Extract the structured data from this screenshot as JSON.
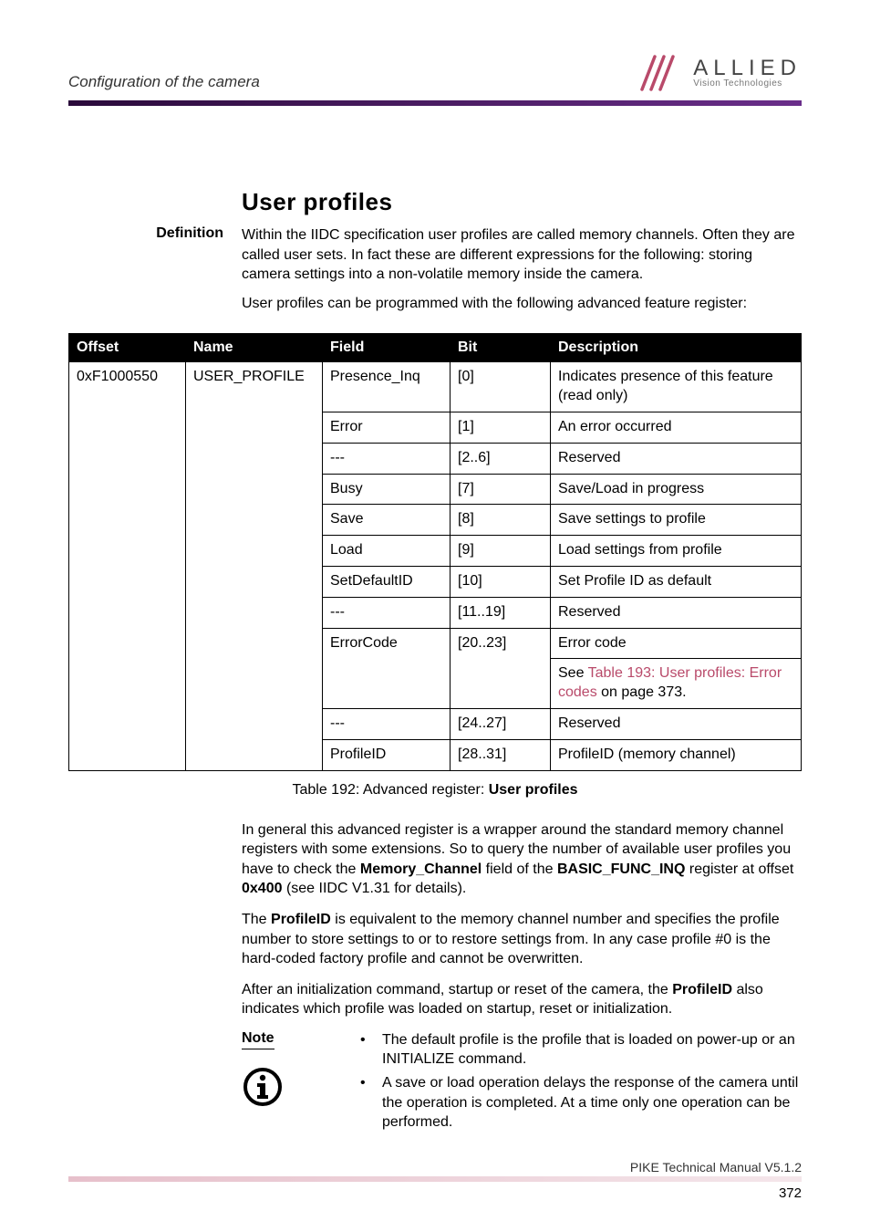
{
  "header": {
    "section": "Configuration of the camera",
    "brand_main": "ALLIED",
    "brand_sub": "Vision Technologies"
  },
  "title": "User profiles",
  "definition": {
    "label": "Definition",
    "para1": "Within the IIDC specification user profiles are called memory channels. Often they are called user sets. In fact these are different expressions for the following: storing camera settings into a non-volatile memory inside the camera.",
    "para2": "User profiles can be programmed with the following advanced feature register:"
  },
  "table": {
    "headers": {
      "offset": "Offset",
      "name": "Name",
      "field": "Field",
      "bit": "Bit",
      "description": "Description"
    },
    "offset": "0xF1000550",
    "name": "USER_PROFILE",
    "rows": [
      {
        "field": "Presence_Inq",
        "bit": "[0]",
        "desc": "Indicates presence of this feature (read only)"
      },
      {
        "field": "Error",
        "bit": "[1]",
        "desc": "An error occurred"
      },
      {
        "field": "---",
        "bit": "[2..6]",
        "desc": "Reserved"
      },
      {
        "field": "Busy",
        "bit": "[7]",
        "desc": "Save/Load in progress"
      },
      {
        "field": "Save",
        "bit": "[8]",
        "desc": "Save settings to profile"
      },
      {
        "field": "Load",
        "bit": "[9]",
        "desc": "Load settings from profile"
      },
      {
        "field": "SetDefaultID",
        "bit": "[10]",
        "desc": "Set Profile ID as default"
      },
      {
        "field": "---",
        "bit": "[11..19]",
        "desc": "Reserved"
      },
      {
        "field": "ErrorCode",
        "bit": "[20..23]",
        "desc": "Error code",
        "desc2_prefix": "See ",
        "desc2_link": "Table 193: User profiles: Error codes",
        "desc2_suffix": " on page 373."
      },
      {
        "field": "---",
        "bit": "[24..27]",
        "desc": "Reserved"
      },
      {
        "field": "ProfileID",
        "bit": "[28..31]",
        "desc": "ProfileID (memory channel)"
      }
    ]
  },
  "caption": {
    "prefix": "Table 192: Advanced register: ",
    "strong": "User profiles"
  },
  "body": {
    "p1_a": "In general this advanced register is a wrapper around the standard memory channel registers with some extensions. So to query the number of available user profiles you have to check the ",
    "p1_b": "Memory_Channel",
    "p1_c": " field of the ",
    "p1_d": "BASIC_FUNC_INQ",
    "p1_e": " register at offset ",
    "p1_f": "0x400",
    "p1_g": " (see IIDC V1.31 for details).",
    "p2_a": "The ",
    "p2_b": "ProfileID",
    "p2_c": "   is equivalent to the memory channel number and specifies the profile number to store settings to or to restore settings from. In any case profile #0 is the hard-coded factory profile and cannot be overwritten.",
    "p3_a": "After an initialization command, startup or reset of the camera, the ",
    "p3_b": "ProfileID",
    "p3_c": " also indicates which profile was loaded on startup, reset or initialization."
  },
  "note": {
    "label": "Note",
    "items": [
      "The default profile is the profile that is loaded on power-up or an INITIALIZE command.",
      "A save or load operation delays the response of the camera until the operation is completed. At a time only one operation can be performed."
    ]
  },
  "footer": {
    "docname": "PIKE Technical Manual V5.1.2",
    "page": "372"
  }
}
